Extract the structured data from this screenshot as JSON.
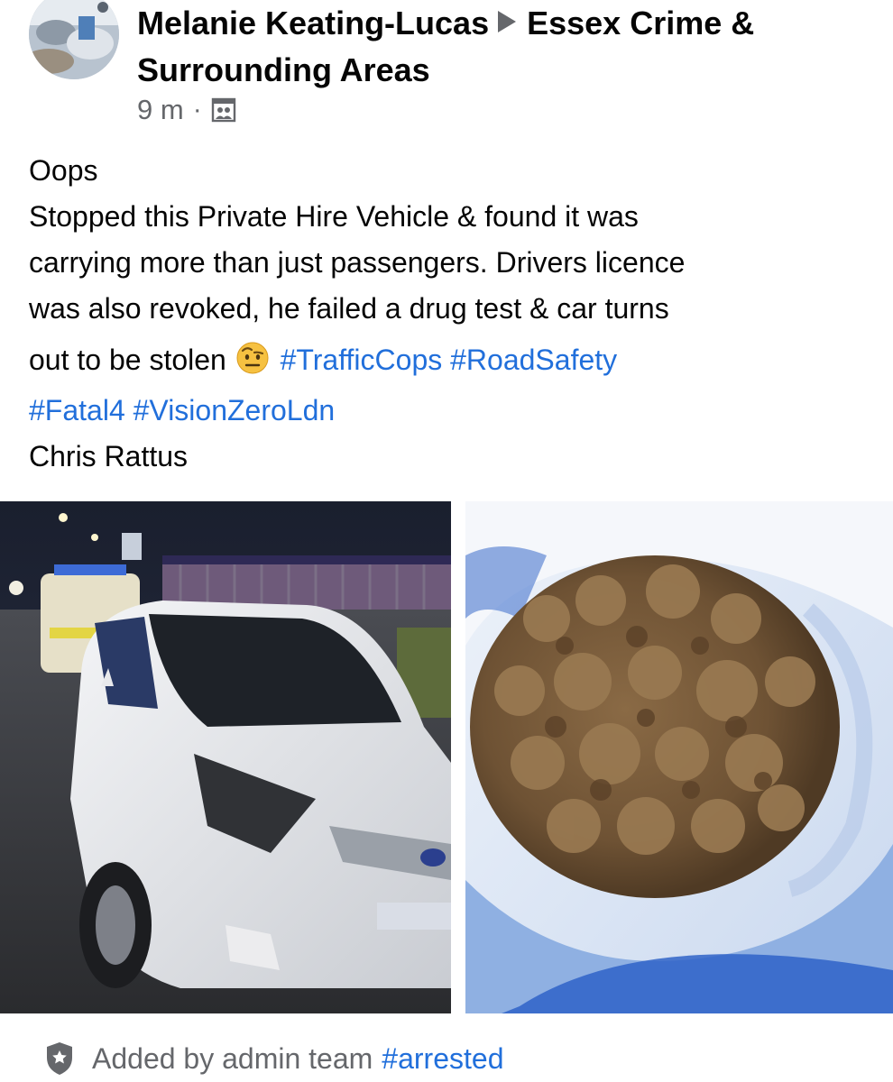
{
  "post": {
    "author": "Melanie Keating-Lucas",
    "group_line1": "Essex Crime &",
    "group_line2": "Surrounding Areas",
    "time": "9 m",
    "separator": "·"
  },
  "body": {
    "line1": "Oops",
    "line2": "Stopped this Private Hire Vehicle & found it was",
    "line3": "carrying more than just passengers. Drivers licence",
    "line4": "was also revoked, he failed a drug test & car turns",
    "line5_text": "out to be stolen",
    "hashtags_line5": [
      "#TrafficCops",
      "#RoadSafety"
    ],
    "hashtags_line6": [
      "#Fatal4",
      "#VisionZeroLdn"
    ],
    "signature": "Chris Rattus"
  },
  "icons": {
    "audience": "group-privacy-icon",
    "emoji": "face-with-raised-eyebrow-emoji",
    "footer": "shield-icon"
  },
  "footer": {
    "added_by": "Added by admin team",
    "hashtag": "#arrested"
  },
  "colors": {
    "hashtag": "#216fdb",
    "meta": "#65676b",
    "text": "#050505"
  }
}
